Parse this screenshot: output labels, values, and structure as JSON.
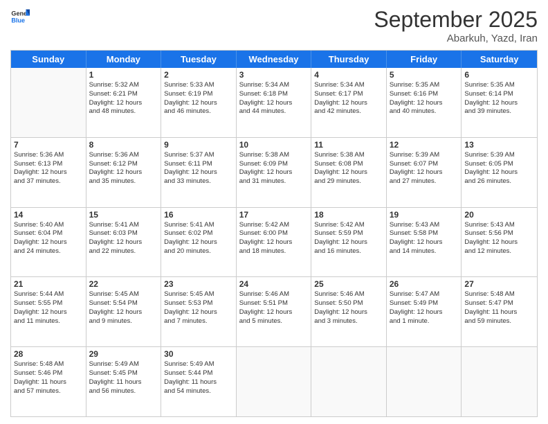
{
  "header": {
    "logo_general": "General",
    "logo_blue": "Blue",
    "month_title": "September 2025",
    "location": "Abarkuh, Yazd, Iran"
  },
  "weekdays": [
    "Sunday",
    "Monday",
    "Tuesday",
    "Wednesday",
    "Thursday",
    "Friday",
    "Saturday"
  ],
  "rows": [
    [
      {
        "day": "",
        "lines": []
      },
      {
        "day": "1",
        "lines": [
          "Sunrise: 5:32 AM",
          "Sunset: 6:21 PM",
          "Daylight: 12 hours",
          "and 48 minutes."
        ]
      },
      {
        "day": "2",
        "lines": [
          "Sunrise: 5:33 AM",
          "Sunset: 6:19 PM",
          "Daylight: 12 hours",
          "and 46 minutes."
        ]
      },
      {
        "day": "3",
        "lines": [
          "Sunrise: 5:34 AM",
          "Sunset: 6:18 PM",
          "Daylight: 12 hours",
          "and 44 minutes."
        ]
      },
      {
        "day": "4",
        "lines": [
          "Sunrise: 5:34 AM",
          "Sunset: 6:17 PM",
          "Daylight: 12 hours",
          "and 42 minutes."
        ]
      },
      {
        "day": "5",
        "lines": [
          "Sunrise: 5:35 AM",
          "Sunset: 6:16 PM",
          "Daylight: 12 hours",
          "and 40 minutes."
        ]
      },
      {
        "day": "6",
        "lines": [
          "Sunrise: 5:35 AM",
          "Sunset: 6:14 PM",
          "Daylight: 12 hours",
          "and 39 minutes."
        ]
      }
    ],
    [
      {
        "day": "7",
        "lines": [
          "Sunrise: 5:36 AM",
          "Sunset: 6:13 PM",
          "Daylight: 12 hours",
          "and 37 minutes."
        ]
      },
      {
        "day": "8",
        "lines": [
          "Sunrise: 5:36 AM",
          "Sunset: 6:12 PM",
          "Daylight: 12 hours",
          "and 35 minutes."
        ]
      },
      {
        "day": "9",
        "lines": [
          "Sunrise: 5:37 AM",
          "Sunset: 6:11 PM",
          "Daylight: 12 hours",
          "and 33 minutes."
        ]
      },
      {
        "day": "10",
        "lines": [
          "Sunrise: 5:38 AM",
          "Sunset: 6:09 PM",
          "Daylight: 12 hours",
          "and 31 minutes."
        ]
      },
      {
        "day": "11",
        "lines": [
          "Sunrise: 5:38 AM",
          "Sunset: 6:08 PM",
          "Daylight: 12 hours",
          "and 29 minutes."
        ]
      },
      {
        "day": "12",
        "lines": [
          "Sunrise: 5:39 AM",
          "Sunset: 6:07 PM",
          "Daylight: 12 hours",
          "and 27 minutes."
        ]
      },
      {
        "day": "13",
        "lines": [
          "Sunrise: 5:39 AM",
          "Sunset: 6:05 PM",
          "Daylight: 12 hours",
          "and 26 minutes."
        ]
      }
    ],
    [
      {
        "day": "14",
        "lines": [
          "Sunrise: 5:40 AM",
          "Sunset: 6:04 PM",
          "Daylight: 12 hours",
          "and 24 minutes."
        ]
      },
      {
        "day": "15",
        "lines": [
          "Sunrise: 5:41 AM",
          "Sunset: 6:03 PM",
          "Daylight: 12 hours",
          "and 22 minutes."
        ]
      },
      {
        "day": "16",
        "lines": [
          "Sunrise: 5:41 AM",
          "Sunset: 6:02 PM",
          "Daylight: 12 hours",
          "and 20 minutes."
        ]
      },
      {
        "day": "17",
        "lines": [
          "Sunrise: 5:42 AM",
          "Sunset: 6:00 PM",
          "Daylight: 12 hours",
          "and 18 minutes."
        ]
      },
      {
        "day": "18",
        "lines": [
          "Sunrise: 5:42 AM",
          "Sunset: 5:59 PM",
          "Daylight: 12 hours",
          "and 16 minutes."
        ]
      },
      {
        "day": "19",
        "lines": [
          "Sunrise: 5:43 AM",
          "Sunset: 5:58 PM",
          "Daylight: 12 hours",
          "and 14 minutes."
        ]
      },
      {
        "day": "20",
        "lines": [
          "Sunrise: 5:43 AM",
          "Sunset: 5:56 PM",
          "Daylight: 12 hours",
          "and 12 minutes."
        ]
      }
    ],
    [
      {
        "day": "21",
        "lines": [
          "Sunrise: 5:44 AM",
          "Sunset: 5:55 PM",
          "Daylight: 12 hours",
          "and 11 minutes."
        ]
      },
      {
        "day": "22",
        "lines": [
          "Sunrise: 5:45 AM",
          "Sunset: 5:54 PM",
          "Daylight: 12 hours",
          "and 9 minutes."
        ]
      },
      {
        "day": "23",
        "lines": [
          "Sunrise: 5:45 AM",
          "Sunset: 5:53 PM",
          "Daylight: 12 hours",
          "and 7 minutes."
        ]
      },
      {
        "day": "24",
        "lines": [
          "Sunrise: 5:46 AM",
          "Sunset: 5:51 PM",
          "Daylight: 12 hours",
          "and 5 minutes."
        ]
      },
      {
        "day": "25",
        "lines": [
          "Sunrise: 5:46 AM",
          "Sunset: 5:50 PM",
          "Daylight: 12 hours",
          "and 3 minutes."
        ]
      },
      {
        "day": "26",
        "lines": [
          "Sunrise: 5:47 AM",
          "Sunset: 5:49 PM",
          "Daylight: 12 hours",
          "and 1 minute."
        ]
      },
      {
        "day": "27",
        "lines": [
          "Sunrise: 5:48 AM",
          "Sunset: 5:47 PM",
          "Daylight: 11 hours",
          "and 59 minutes."
        ]
      }
    ],
    [
      {
        "day": "28",
        "lines": [
          "Sunrise: 5:48 AM",
          "Sunset: 5:46 PM",
          "Daylight: 11 hours",
          "and 57 minutes."
        ]
      },
      {
        "day": "29",
        "lines": [
          "Sunrise: 5:49 AM",
          "Sunset: 5:45 PM",
          "Daylight: 11 hours",
          "and 56 minutes."
        ]
      },
      {
        "day": "30",
        "lines": [
          "Sunrise: 5:49 AM",
          "Sunset: 5:44 PM",
          "Daylight: 11 hours",
          "and 54 minutes."
        ]
      },
      {
        "day": "",
        "lines": []
      },
      {
        "day": "",
        "lines": []
      },
      {
        "day": "",
        "lines": []
      },
      {
        "day": "",
        "lines": []
      }
    ]
  ]
}
